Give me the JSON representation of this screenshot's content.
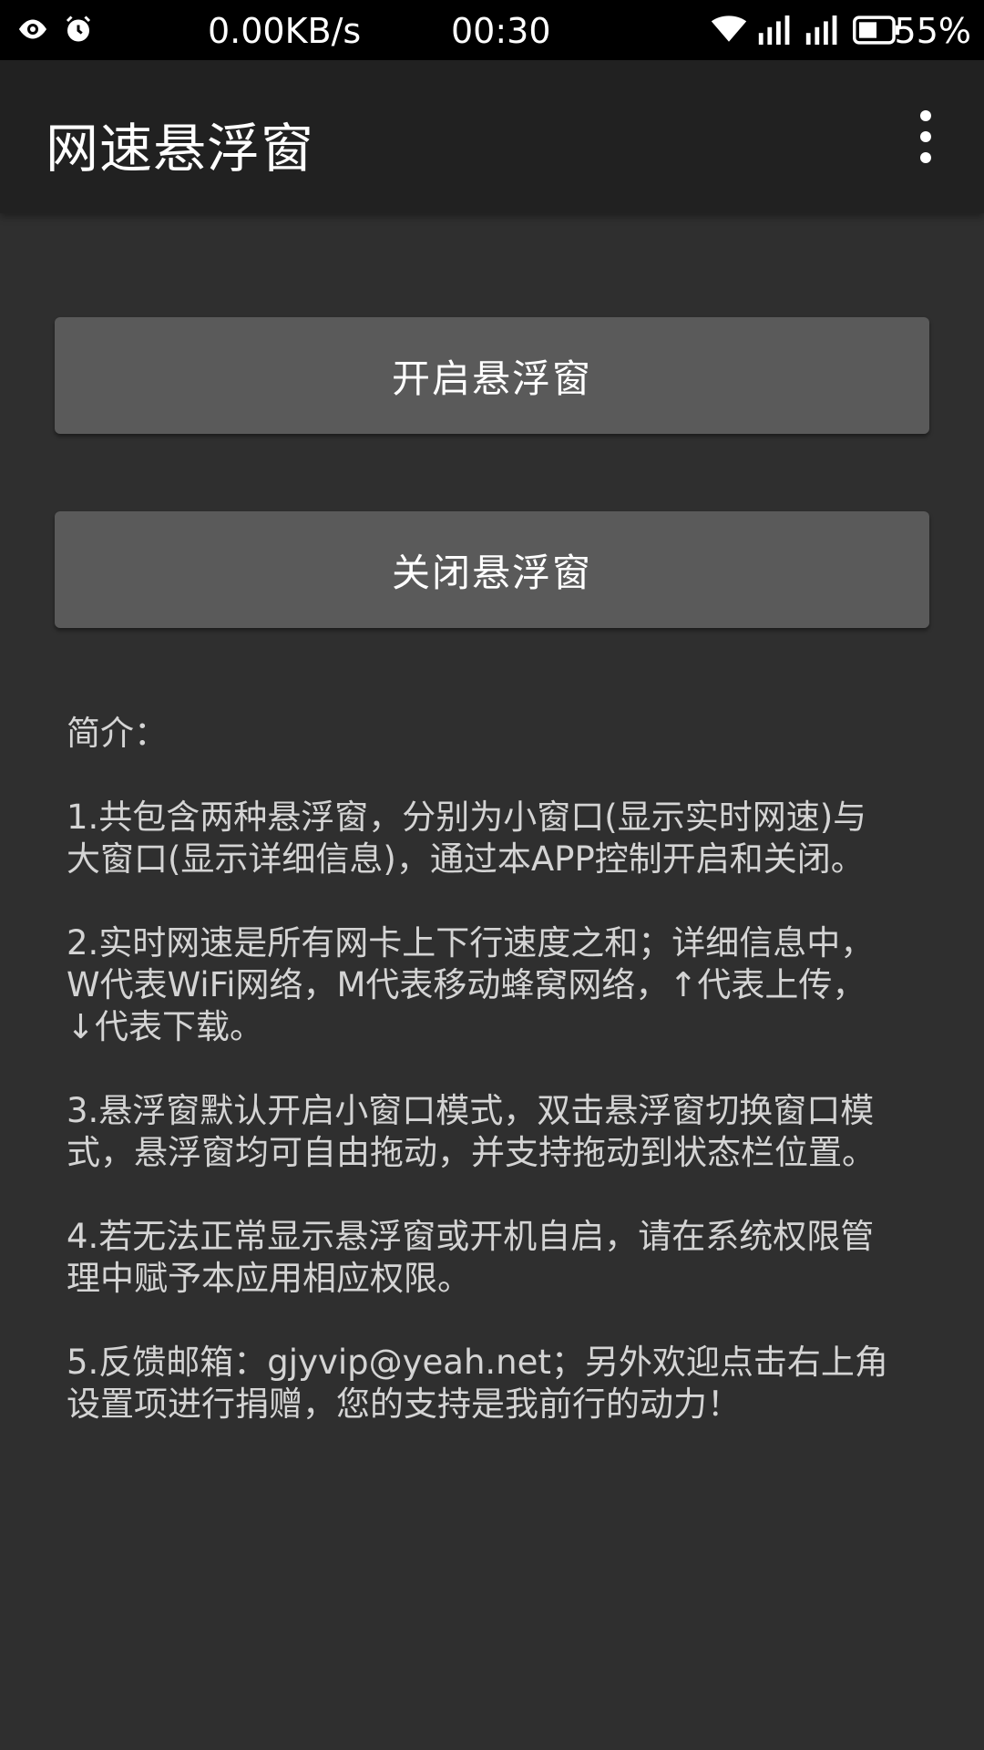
{
  "status_bar": {
    "net_speed": "0.00KB/s",
    "time": "00:30",
    "battery_percent": "55%",
    "icons_left": [
      "eye-icon",
      "alarm-icon"
    ],
    "icons_right": [
      "wifi-icon",
      "signal-icon",
      "signal-icon",
      "battery-icon"
    ]
  },
  "toolbar": {
    "title": "网速悬浮窗"
  },
  "buttons": {
    "open_label": "开启悬浮窗",
    "close_label": "关闭悬浮窗"
  },
  "intro": {
    "heading": "简介：",
    "paragraphs": [
      "1.共包含两种悬浮窗，分别为小窗口(显示实时网速)与\n大窗口(显示详细信息)，通过本APP控制开启和关闭。",
      "2.实时网速是所有网卡上下行速度之和；详细信息中，\nW代表WiFi网络，M代表移动蜂窝网络，↑代表上传，\n↓代表下载。",
      "3.悬浮窗默认开启小窗口模式，双击悬浮窗切换窗口模\n式，悬浮窗均可自由拖动，并支持拖动到状态栏位置。",
      "4.若无法正常显示悬浮窗或开机自启，请在系统权限管\n理中赋予本应用相应权限。",
      "5.反馈邮箱：gjyvip@yeah.net；另外欢迎点击右上角\n设置项进行捐赠，您的支持是我前行的动力！"
    ]
  },
  "colors": {
    "background": "#2f2f2f",
    "toolbar": "#212121",
    "button": "#5a5a5a",
    "text": "#d4d4d4"
  }
}
